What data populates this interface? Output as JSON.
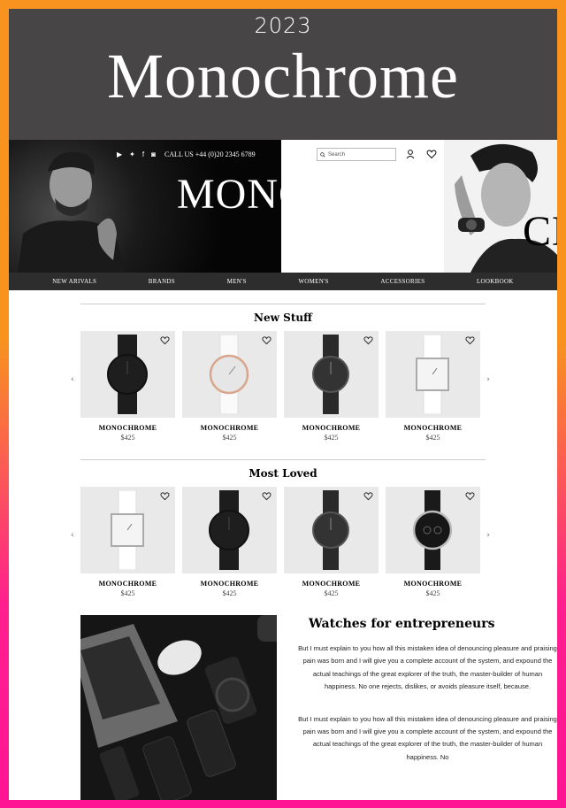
{
  "banner": {
    "year": "2023",
    "title": "Monochrome"
  },
  "header": {
    "call": "CALL US +44 (0)20 2345 6789",
    "search_placeholder": "Search",
    "logo_line1": "MONO",
    "logo_line2": "CHROME"
  },
  "nav": [
    "NEW ARIVALS",
    "BRANDS",
    "MEN'S",
    "WOMEN'S",
    "ACCESSORIES",
    "LOOKBOOK"
  ],
  "new_stuff": {
    "title": "New Stuff",
    "products": [
      {
        "name": "MONOCHROME",
        "price": "$425"
      },
      {
        "name": "MONOCHROME",
        "price": "$425"
      },
      {
        "name": "MONOCHROME",
        "price": "$425"
      },
      {
        "name": "MONOCHROME",
        "price": "$425"
      }
    ]
  },
  "most_loved": {
    "title": "Most Loved",
    "products": [
      {
        "name": "MONOCHROME",
        "price": "$425"
      },
      {
        "name": "MONOCHROME",
        "price": "$425"
      },
      {
        "name": "MONOCHROME",
        "price": "$425"
      },
      {
        "name": "MONOCHROME",
        "price": "$425"
      }
    ]
  },
  "about": {
    "title": "Watches for entrepreneurs",
    "para1": "But I must explain to you how all this mistaken idea of denouncing pleasure and praising pain was born and I will give you a complete account of the system, and expound the actual teachings of the great explorer of the truth, the master-builder of human happiness. No one rejects, dislikes, or avoids pleasure itself, because.",
    "para2": "But I must explain to you how all this mistaken idea of denouncing pleasure and praising pain was born and I will give you a complete account of the system, and expound the actual teachings of the great explorer of the truth, the master-builder of human happiness. No"
  },
  "colors": {
    "banner": "#474545",
    "nav": "#2d2d2d",
    "frame_top": "#f7931e",
    "frame_bottom": "#ff1493"
  }
}
